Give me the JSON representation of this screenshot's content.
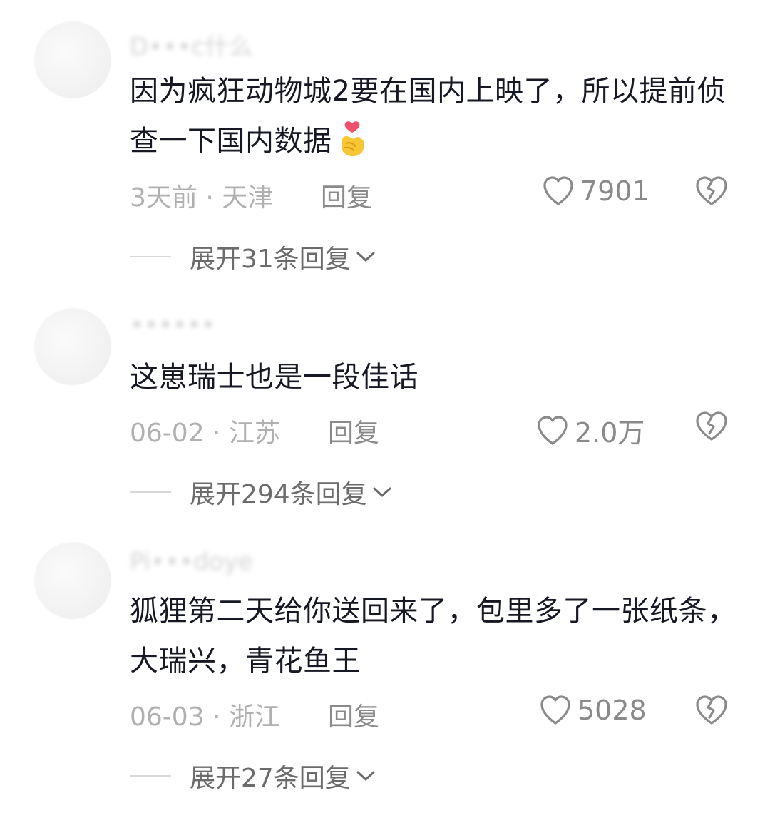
{
  "comments": [
    {
      "username": "D•••c什么",
      "text": "因为疯狂动物城2要在国内上映了，所以提前侦查一下国内数据",
      "emoji": "finger-heart-emoji",
      "meta": "3天前 · 天津",
      "reply": "回复",
      "likes": "7901",
      "expand": "展开31条回复"
    },
    {
      "username": "••••••",
      "text": "这崽瑞士也是一段佳话",
      "meta": "06-02 · 江苏",
      "reply": "回复",
      "likes": "2.0万",
      "expand": "展开294条回复"
    },
    {
      "username": "Pi•••doye",
      "text": "狐狸第二天给你送回来了，包里多了一张纸条，大瑞兴，青花鱼王",
      "meta": "06-03 · 浙江",
      "reply": "回复",
      "likes": "5028",
      "expand": "展开27条回复"
    }
  ],
  "icons": {
    "like": "heart-outline-icon",
    "dislike": "broken-heart-icon",
    "expand": "chevron-down-icon"
  },
  "colors": {
    "text": "#161823",
    "meta": "#b0b0b0",
    "secondary": "#8a8a8a",
    "icon": "#8a8a8a"
  }
}
